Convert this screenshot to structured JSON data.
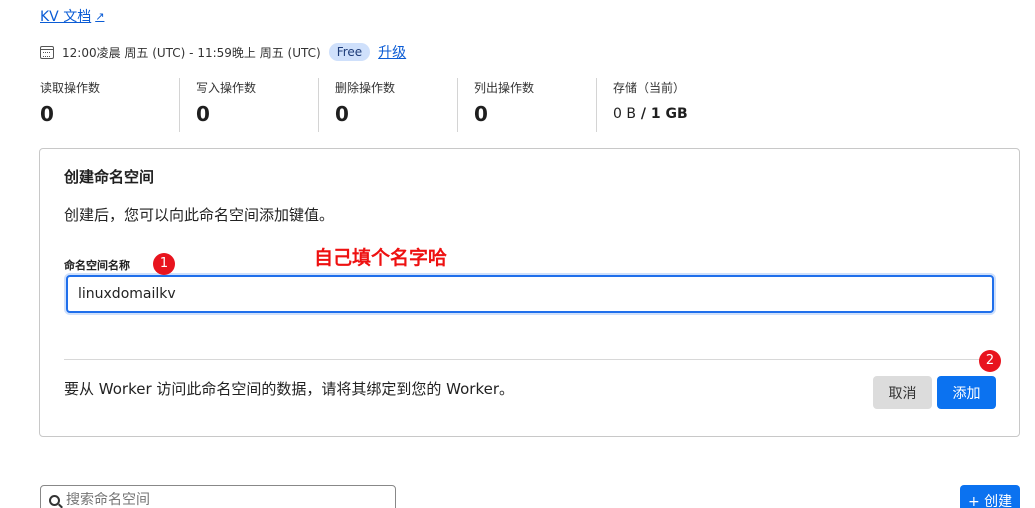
{
  "header": {
    "docs_link": "KV 文档",
    "period": "12:00凌晨 周五 (UTC) - 11:59晚上 周五 (UTC)",
    "plan_badge": "Free",
    "upgrade_link": "升级"
  },
  "stats": [
    {
      "label": "读取操作数",
      "value": "0"
    },
    {
      "label": "写入操作数",
      "value": "0"
    },
    {
      "label": "删除操作数",
      "value": "0"
    },
    {
      "label": "列出操作数",
      "value": "0"
    },
    {
      "label": "存储（当前）",
      "value_used": "0 B",
      "value_sep": " / ",
      "value_total": "1 GB"
    }
  ],
  "create_card": {
    "title": "创建命名空间",
    "description": "创建后，您可以向此命名空间添加键值。",
    "field_label": "命名空间名称",
    "field_value": "linuxdomailkv",
    "bind_note": "要从 Worker 访问此命名空间的数据，请将其绑定到您的 Worker。",
    "cancel_label": "取消",
    "add_label": "添加"
  },
  "annotations": {
    "marker_1": "1",
    "marker_2": "2",
    "note": "自己填个名字哈",
    "color": "#e8141e"
  },
  "list": {
    "search_placeholder": "搜索命名空间",
    "create_label": "+ 创建"
  },
  "colors": {
    "accent": "#0b72f0",
    "link": "#0b5cd5",
    "badge_bg": "#cfe0fb"
  }
}
